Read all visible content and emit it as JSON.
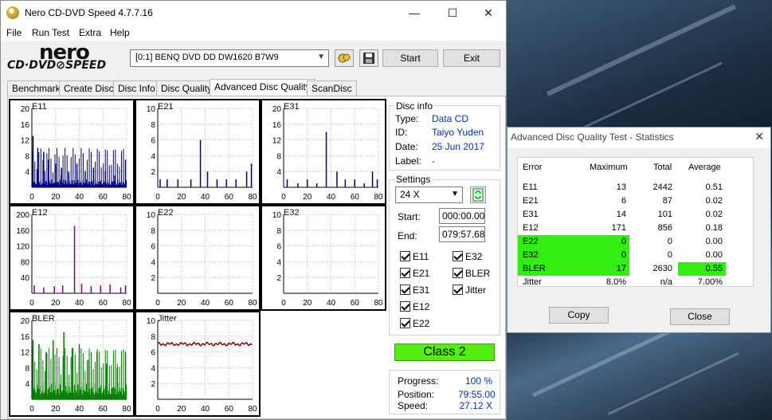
{
  "window": {
    "title": "Nero CD-DVD Speed 4.7.7.16",
    "minimize": "—",
    "maximize": "☐",
    "close": "✕"
  },
  "menu": [
    "File",
    "Run Test",
    "Extra",
    "Help"
  ],
  "logo": {
    "nero": "nero",
    "sub": "CD·DVD⊘SPEED"
  },
  "toolbar": {
    "drive": "[0:1]   BENQ DVD DD DW1620 B7W9",
    "start": "Start",
    "exit": "Exit"
  },
  "tabs": [
    "Benchmark",
    "Create Disc",
    "Disc Info",
    "Disc Quality",
    "Advanced Disc Quality",
    "ScanDisc"
  ],
  "disc_info": {
    "title": "Disc info",
    "rows": [
      {
        "label": "Type:",
        "value": "Data CD"
      },
      {
        "label": "ID:",
        "value": "Taiyo Yuden"
      },
      {
        "label": "Date:",
        "value": "25 Jun 2017"
      },
      {
        "label": "Label:",
        "value": "-"
      }
    ]
  },
  "settings": {
    "title": "Settings",
    "speed": "24 X",
    "start_label": "Start:",
    "start_value": "000:00.00",
    "end_label": "End:",
    "end_value": "079:57.68",
    "checks": [
      {
        "label": "E11",
        "checked": true
      },
      {
        "label": "E32",
        "checked": true
      },
      {
        "label": "E21",
        "checked": true
      },
      {
        "label": "BLER",
        "checked": true
      },
      {
        "label": "E31",
        "checked": true
      },
      {
        "label": "Jitter",
        "checked": true
      },
      {
        "label": "E12",
        "checked": true
      },
      {
        "label": "E22",
        "checked": true
      }
    ]
  },
  "quality": {
    "class": "Class 2"
  },
  "progress": {
    "rows": [
      {
        "label": "Progress:",
        "value": "100 %"
      },
      {
        "label": "Position:",
        "value": "79:55.00"
      },
      {
        "label": "Speed:",
        "value": "27.12 X"
      }
    ]
  },
  "stats": {
    "title": "Advanced Disc Quality Test - Statistics",
    "close": "✕",
    "headers": [
      "Error",
      "Maximum",
      "Total",
      "Average"
    ],
    "rows": [
      {
        "error": "E11",
        "max": "13",
        "total": "2442",
        "avg": "0.51",
        "hl_max": false,
        "hl_avg": false
      },
      {
        "error": "E21",
        "max": "6",
        "total": "87",
        "avg": "0.02",
        "hl_max": false,
        "hl_avg": false
      },
      {
        "error": "E31",
        "max": "14",
        "total": "101",
        "avg": "0.02",
        "hl_max": false,
        "hl_avg": false
      },
      {
        "error": "E12",
        "max": "171",
        "total": "856",
        "avg": "0.18",
        "hl_max": false,
        "hl_avg": false
      },
      {
        "error": "E22",
        "max": "0",
        "total": "0",
        "avg": "0.00",
        "hl_max": true,
        "hl_avg": false
      },
      {
        "error": "E32",
        "max": "0",
        "total": "0",
        "avg": "0.00",
        "hl_max": true,
        "hl_avg": false
      },
      {
        "error": "BLER",
        "max": "17",
        "total": "2630",
        "avg": "0.55",
        "hl_max": true,
        "hl_avg": true
      },
      {
        "error": "Jitter",
        "max": "8.0%",
        "total": "n/a",
        "avg": "7.00%",
        "hl_max": false,
        "hl_avg": false
      }
    ],
    "copy": "Copy",
    "close_btn": "Close",
    "colors": {
      "green": "#33ee11",
      "lime": "#88ee22"
    }
  },
  "chart_data": [
    {
      "name": "E11",
      "type": "bar",
      "yticks": [
        "20",
        "16",
        "12",
        "8",
        "4"
      ],
      "xticks": [
        "0",
        "20",
        "40",
        "60",
        "80"
      ],
      "ylim": [
        0,
        20
      ],
      "xlim": [
        0,
        80
      ],
      "color": "#000080",
      "peaks": [
        [
          1,
          13
        ],
        [
          5,
          10
        ],
        [
          10,
          9
        ],
        [
          14,
          7
        ],
        [
          20,
          6
        ],
        [
          25,
          5
        ],
        [
          31,
          4
        ],
        [
          38,
          6
        ],
        [
          45,
          4
        ],
        [
          52,
          5
        ],
        [
          62,
          4
        ],
        [
          70,
          3
        ],
        [
          79,
          7
        ]
      ],
      "base": 2
    },
    {
      "name": "E21",
      "type": "bar",
      "yticks": [
        "10",
        "8",
        "6",
        "4",
        "2"
      ],
      "xticks": [
        "0",
        "20",
        "40",
        "60",
        "80"
      ],
      "ylim": [
        0,
        10
      ],
      "xlim": [
        0,
        80
      ],
      "color": "#000080",
      "peaks": [
        [
          2,
          1
        ],
        [
          8,
          1
        ],
        [
          17,
          1
        ],
        [
          28,
          1
        ],
        [
          36,
          6
        ],
        [
          42,
          2
        ],
        [
          50,
          1
        ],
        [
          58,
          1
        ],
        [
          66,
          1
        ],
        [
          75,
          2
        ],
        [
          79,
          3
        ]
      ],
      "base": 0
    },
    {
      "name": "E31",
      "type": "bar",
      "yticks": [
        "20",
        "16",
        "12",
        "8",
        "4"
      ],
      "xticks": [
        "0",
        "20",
        "40",
        "60",
        "80"
      ],
      "ylim": [
        0,
        20
      ],
      "xlim": [
        0,
        80
      ],
      "color": "#000080",
      "peaks": [
        [
          3,
          2
        ],
        [
          12,
          1
        ],
        [
          20,
          2
        ],
        [
          28,
          1
        ],
        [
          36,
          14
        ],
        [
          45,
          4
        ],
        [
          52,
          2
        ],
        [
          60,
          2
        ],
        [
          68,
          1
        ],
        [
          75,
          4
        ],
        [
          79,
          2
        ]
      ],
      "base": 0
    },
    {
      "name": "E12",
      "type": "bar",
      "yticks": [
        "200",
        "160",
        "120",
        "80",
        "40"
      ],
      "xticks": [
        "0",
        "20",
        "40",
        "60",
        "80"
      ],
      "ylim": [
        0,
        200
      ],
      "xlim": [
        0,
        80
      ],
      "color": "#800080",
      "peaks": [
        [
          2,
          20
        ],
        [
          10,
          15
        ],
        [
          19,
          18
        ],
        [
          26,
          20
        ],
        [
          36,
          171
        ],
        [
          42,
          25
        ],
        [
          50,
          18
        ],
        [
          58,
          20
        ],
        [
          66,
          22
        ],
        [
          75,
          15
        ],
        [
          79,
          20
        ]
      ],
      "base": 0
    },
    {
      "name": "E22",
      "type": "bar",
      "yticks": [
        "10",
        "8",
        "6",
        "4",
        "2"
      ],
      "xticks": [
        "0",
        "20",
        "40",
        "60",
        "80"
      ],
      "ylim": [
        0,
        10
      ],
      "xlim": [
        0,
        80
      ],
      "color": "#000080",
      "peaks": [],
      "base": 0
    },
    {
      "name": "E32",
      "type": "bar",
      "yticks": [
        "10",
        "8",
        "6",
        "4",
        "2"
      ],
      "xticks": [
        "0",
        "20",
        "40",
        "60",
        "80"
      ],
      "ylim": [
        0,
        10
      ],
      "xlim": [
        0,
        80
      ],
      "color": "#000080",
      "peaks": [],
      "base": 0
    },
    {
      "name": "BLER",
      "type": "bar",
      "yticks": [
        "20",
        "16",
        "12",
        "8",
        "4"
      ],
      "xticks": [
        "0",
        "20",
        "40",
        "60",
        "80"
      ],
      "ylim": [
        0,
        20
      ],
      "xlim": [
        0,
        80
      ],
      "color": "#008000",
      "peaks": [
        [
          1,
          15
        ],
        [
          6,
          14
        ],
        [
          12,
          12
        ],
        [
          18,
          15
        ],
        [
          27,
          17
        ],
        [
          34,
          13
        ],
        [
          40,
          14
        ],
        [
          48,
          10
        ],
        [
          55,
          12
        ],
        [
          63,
          9
        ],
        [
          72,
          8
        ],
        [
          79,
          12
        ]
      ],
      "base": 4
    },
    {
      "name": "Jitter",
      "type": "line",
      "yticks": [
        "10",
        "8",
        "6",
        "4",
        "2"
      ],
      "xticks": [
        "0",
        "20",
        "40",
        "60",
        "80"
      ],
      "ylim": [
        0,
        10
      ],
      "xlim": [
        0,
        80
      ],
      "color": "#800000",
      "level": 7.0
    }
  ]
}
